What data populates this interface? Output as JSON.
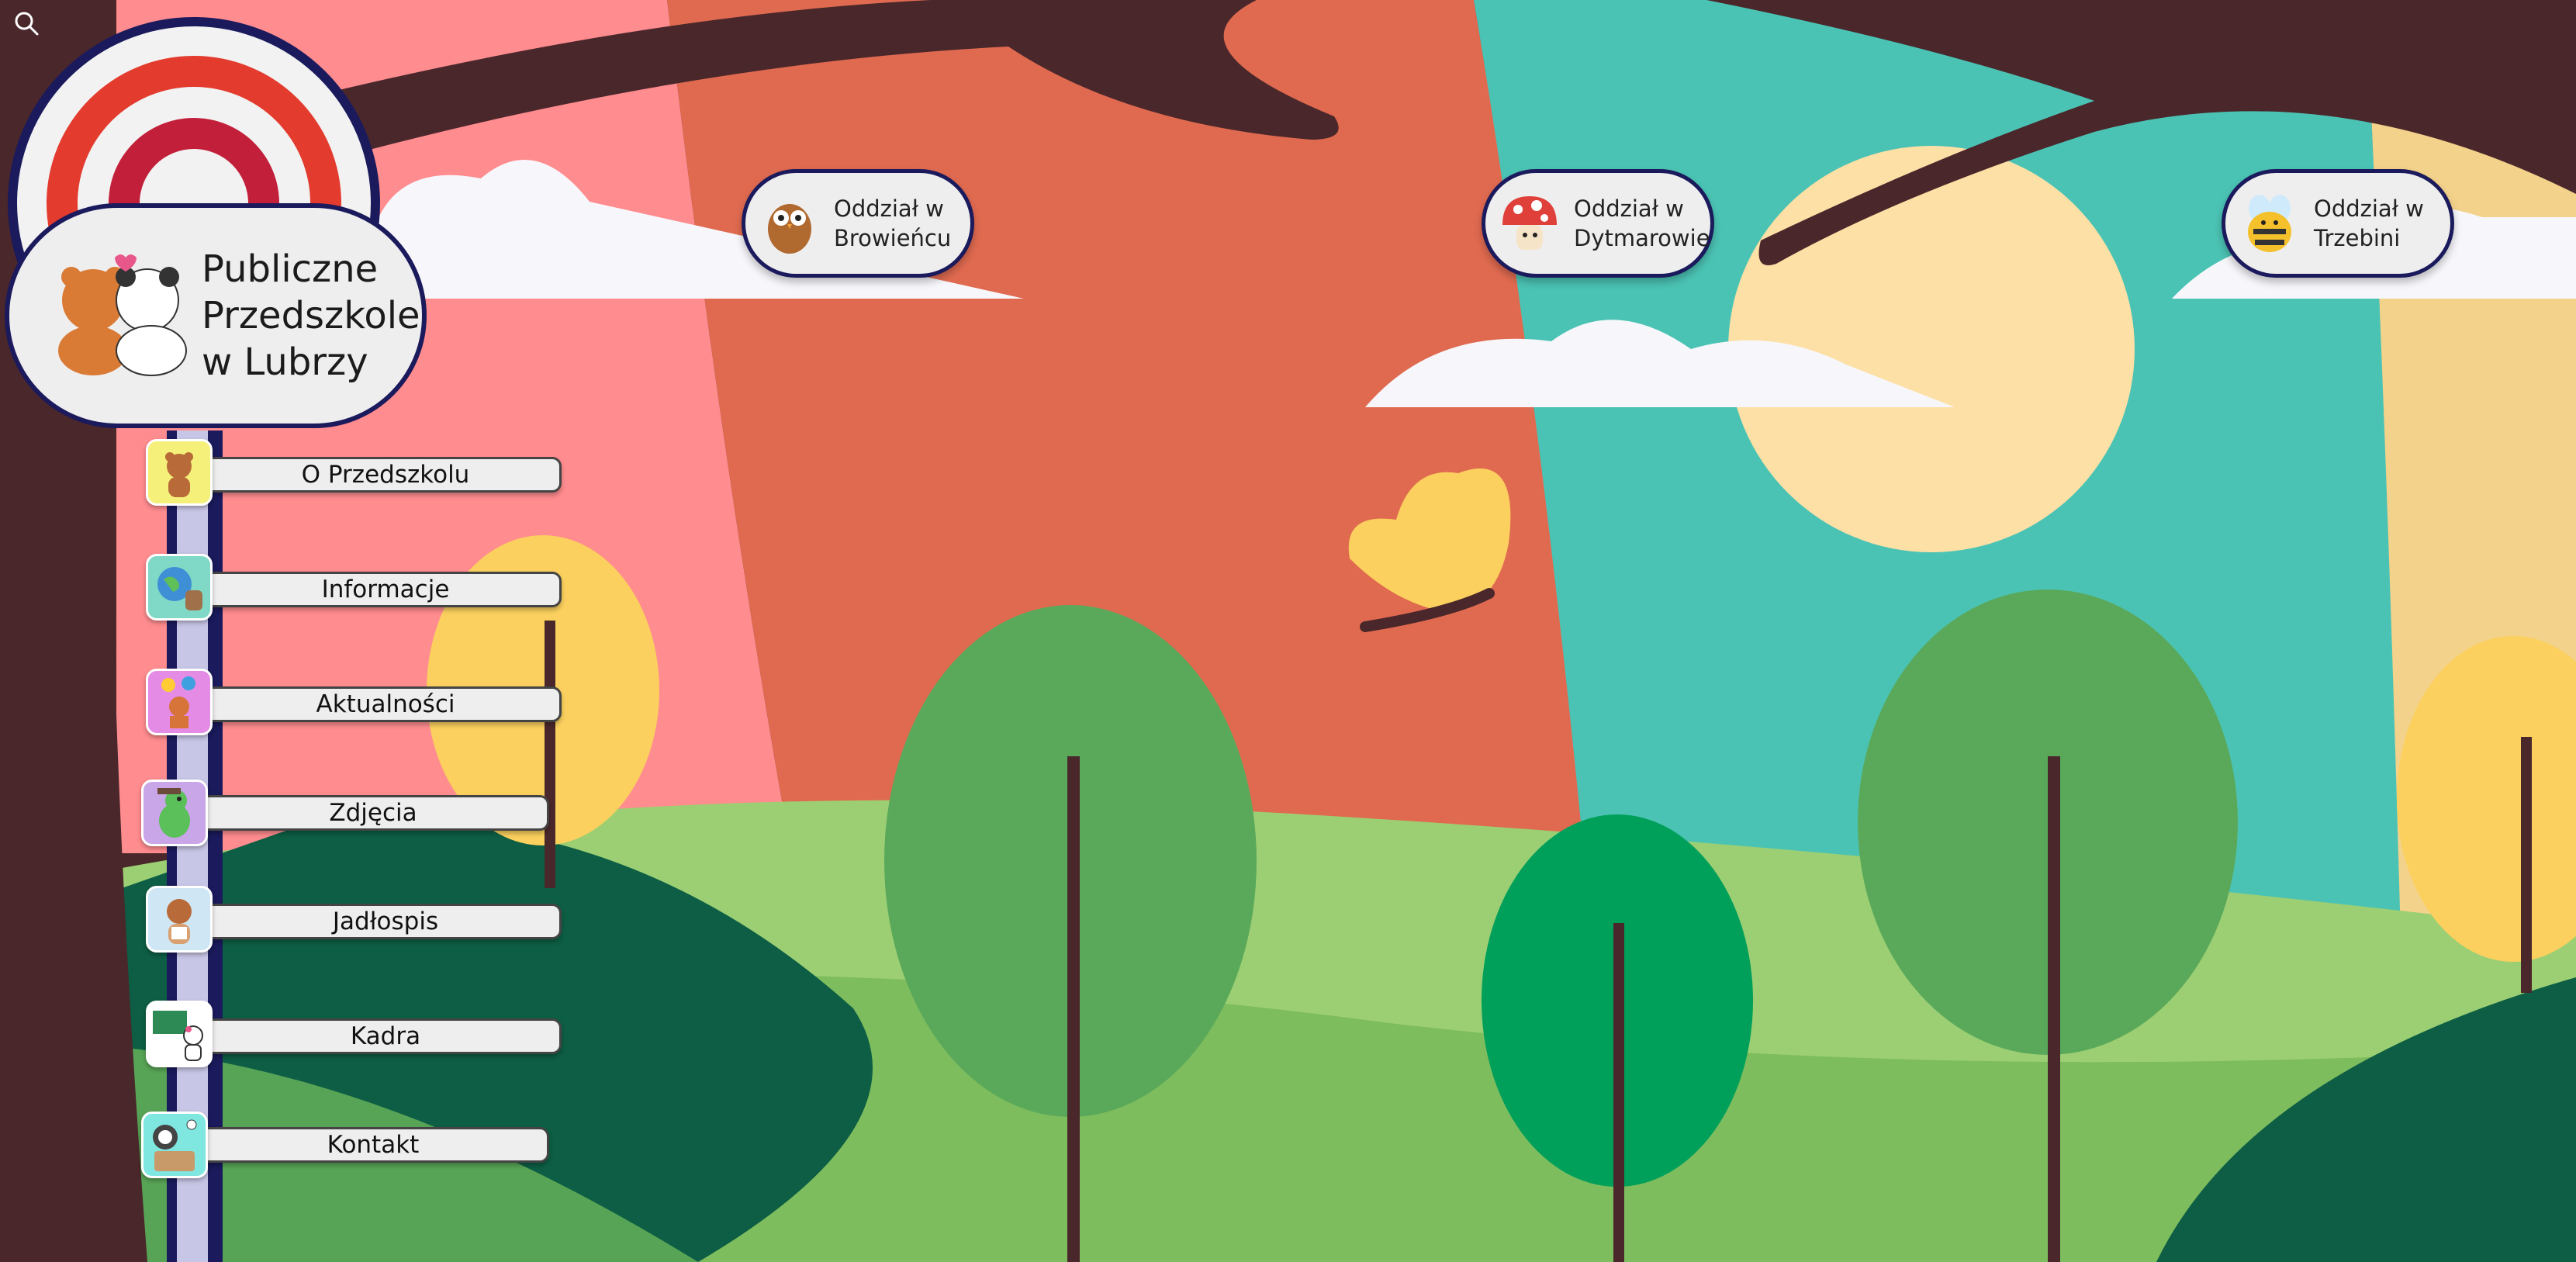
{
  "header": {
    "search_icon": "search-icon",
    "logo_title": "Publiczne\nPrzedszkole\nw Lubrzy"
  },
  "branches": [
    {
      "label_line1": "Oddział w",
      "label_line2": "Browieńcu",
      "icon": "owl-icon"
    },
    {
      "label_line1": "Oddział w",
      "label_line2": "Dytmarowie",
      "icon": "mushroom-icon"
    },
    {
      "label_line1": "Oddział w",
      "label_line2": "Trzebini",
      "icon": "bee-icon"
    }
  ],
  "menu": [
    {
      "label": "O Przedszkolu",
      "icon": "bear-icon",
      "color": "#f4f07a"
    },
    {
      "label": "Informacje",
      "icon": "globe-icon",
      "color": "#7fd9c6"
    },
    {
      "label": "Aktualności",
      "icon": "balloon-icon",
      "color": "#e48be6"
    },
    {
      "label": "Zdjęcia",
      "icon": "dinosaur-icon",
      "color": "#c9a6e8"
    },
    {
      "label": "Jadłospis",
      "icon": "chef-bear-icon",
      "color": "#cfe7f5"
    },
    {
      "label": "Kadra",
      "icon": "teacher-icon",
      "color": "#ffffff"
    },
    {
      "label": "Kontakt",
      "icon": "robot-icon",
      "color": "#7fe6e0"
    }
  ],
  "colors": {
    "navy": "#1a1a5c",
    "brown": "#4a272b",
    "pink": "#ff8c8f",
    "orange": "#e06a50",
    "teal": "#4bc3b4",
    "grass": "#9ccf73"
  }
}
